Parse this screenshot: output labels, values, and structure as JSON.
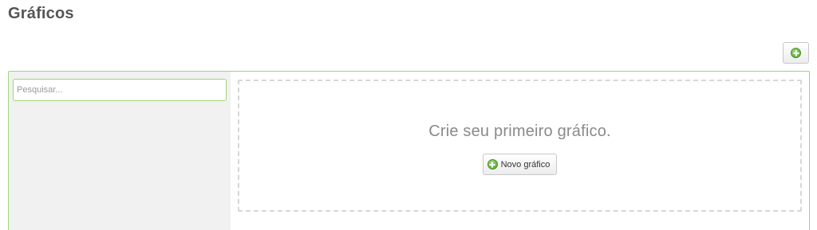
{
  "header": {
    "title": "Gráficos"
  },
  "toolbar": {
    "add_icon": "plus-circle-icon",
    "accent_color": "#6fbf45"
  },
  "sidebar": {
    "search_placeholder": "Pesquisar...",
    "search_value": "",
    "background_color": "#f1f1f1",
    "border_color": "#9fd47a"
  },
  "main": {
    "empty_message": "Crie seu primeiro gráfico.",
    "new_chart_label": "Novo gráfico",
    "new_chart_icon": "plus-circle-icon"
  }
}
